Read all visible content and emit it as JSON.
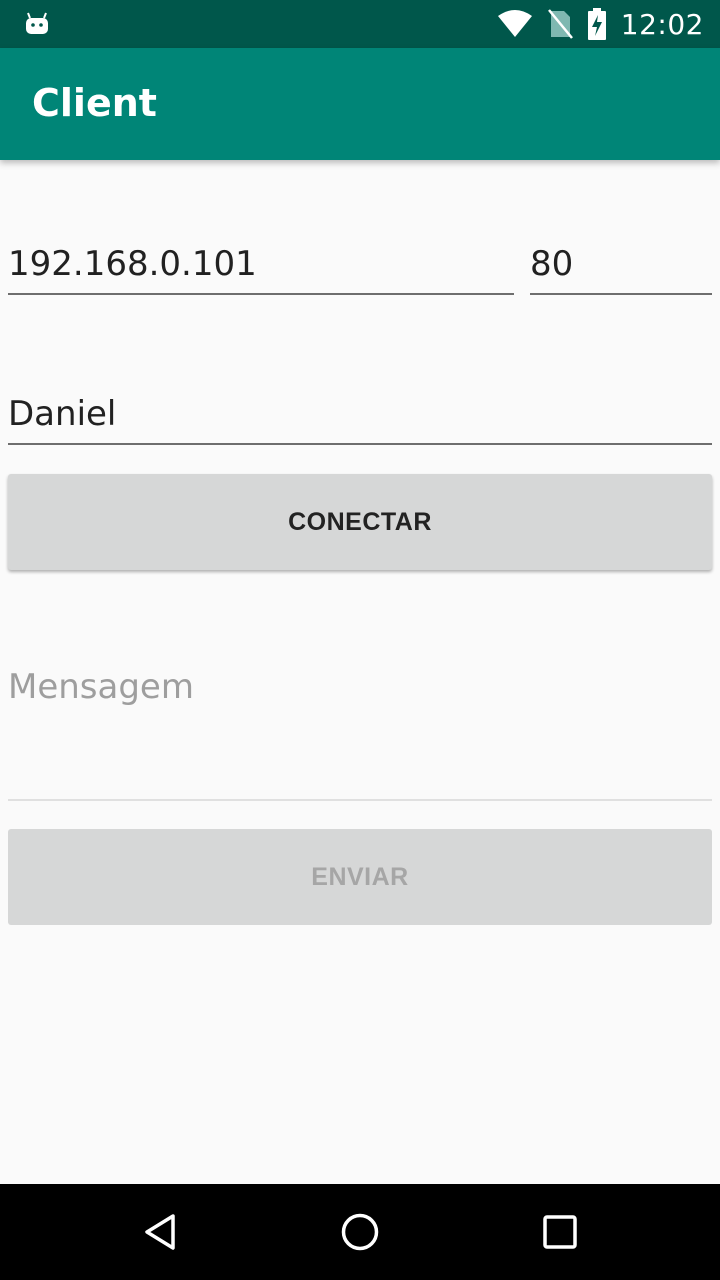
{
  "status_bar": {
    "time": "12:02",
    "icons": [
      "android-debug-icon",
      "wifi-icon",
      "no-sim-icon",
      "battery-charging-icon"
    ]
  },
  "app_bar": {
    "title": "Client"
  },
  "form": {
    "ip_value": "192.168.0.101",
    "port_value": "80",
    "name_value": "Daniel",
    "connect_label": "CONECTAR",
    "message_placeholder": "Mensagem",
    "message_value": "",
    "send_label": "ENVIAR"
  },
  "nav_bar": {
    "icons": [
      "back-icon",
      "home-icon",
      "recents-icon"
    ]
  },
  "colors": {
    "status_bar": "#00574b",
    "app_bar": "#008577",
    "background": "#fafafa",
    "button": "#d6d7d7"
  }
}
